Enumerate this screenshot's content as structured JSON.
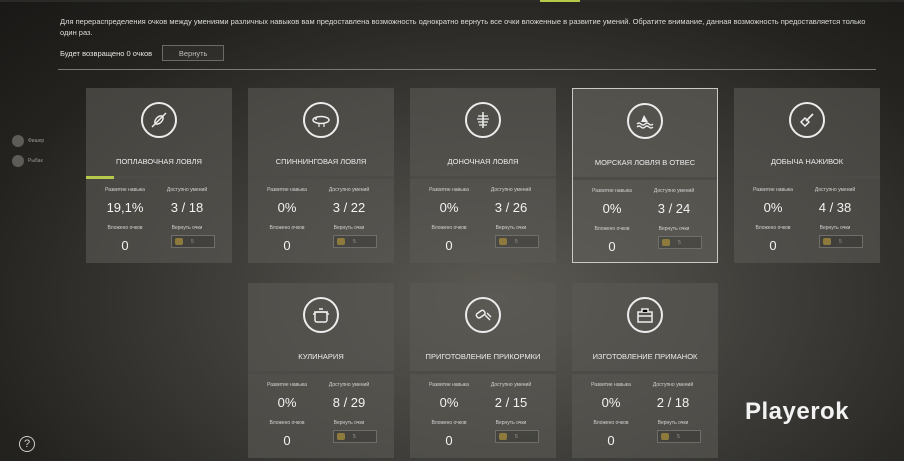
{
  "info_text": "Для перераспределения очков между умениями различных навыков вам предоставлена возможность однократно вернуть все очки вложенные в развитие умений. Обратите внимание, данная возможность предоставляется только один раз.",
  "refund": {
    "label": "Будет возвращено 0 очков",
    "button": "Вернуть"
  },
  "friends": [
    {
      "name": "Фишер"
    },
    {
      "name": "Рыбак"
    }
  ],
  "help_label": "?",
  "watermark": "Playerok",
  "labels": {
    "development": "Развитие навыка",
    "available": "Доступно умений",
    "invested": "Вложено очков",
    "return": "Вернуть очки"
  },
  "skills": [
    {
      "title": "Поплавочная ловля",
      "icon": "float-icon",
      "progress_pct": 19.1,
      "development": "19,1%",
      "available": "3 / 18",
      "invested": "0",
      "refund_cost": "5"
    },
    {
      "title": "Спиннинговая ловля",
      "icon": "lure-icon",
      "progress_pct": 0,
      "development": "0%",
      "available": "3 / 22",
      "invested": "0",
      "refund_cost": "5"
    },
    {
      "title": "Доночная ловля",
      "icon": "bottom-feeder-icon",
      "progress_pct": 0,
      "development": "0%",
      "available": "3 / 26",
      "invested": "0",
      "refund_cost": "5"
    },
    {
      "title": "Морская ловля в отвес",
      "icon": "sea-fishing-icon",
      "progress_pct": 0,
      "development": "0%",
      "available": "3 / 24",
      "invested": "0",
      "refund_cost": "5",
      "selected": true
    },
    {
      "title": "Добыча наживок",
      "icon": "shovel-icon",
      "progress_pct": 0,
      "development": "0%",
      "available": "4 / 38",
      "invested": "0",
      "refund_cost": "5"
    },
    {
      "title": "Кулинария",
      "icon": "pot-icon",
      "progress_pct": 0,
      "development": "0%",
      "available": "8 / 29",
      "invested": "0",
      "refund_cost": "5"
    },
    {
      "title": "Приготовление прикормки",
      "icon": "mixer-icon",
      "progress_pct": 0,
      "development": "0%",
      "available": "2 / 15",
      "invested": "0",
      "refund_cost": "5"
    },
    {
      "title": "Изготовление приманок",
      "icon": "toolbox-icon",
      "progress_pct": 0,
      "development": "0%",
      "available": "2 / 18",
      "invested": "0",
      "refund_cost": "5"
    }
  ]
}
